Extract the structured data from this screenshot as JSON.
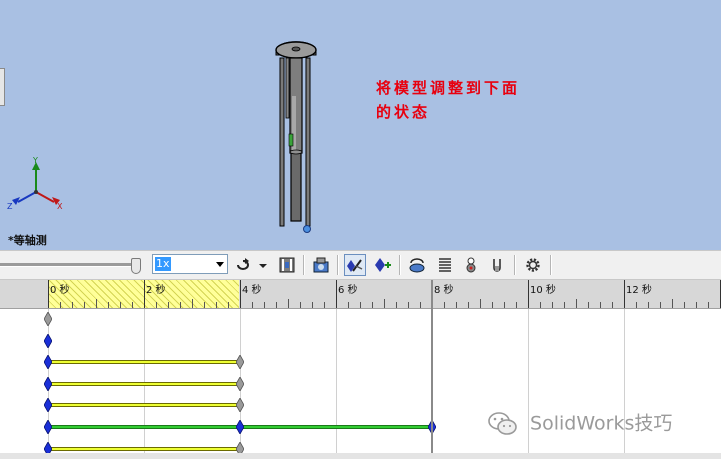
{
  "viewport": {
    "annotation_line1": "将模型调整到下面",
    "annotation_line2": "的状态",
    "view_name": "*等轴测",
    "axis_labels": {
      "y": "Y",
      "x": "X",
      "z": "Z"
    },
    "background_color": "#a9c0e3",
    "annotation_color": "#e8000f"
  },
  "toolbar": {
    "speed_value": "1x",
    "slider_position": 1.0,
    "icons": [
      "playback-mode-icon",
      "save-animation-icon",
      "animation-wizard-icon",
      "autokey-icon",
      "add-key-icon",
      "motor-icon",
      "spring-icon",
      "gravity-icon",
      "contact-icon",
      "settings-icon"
    ]
  },
  "timeline": {
    "unit": "秒",
    "ticks": [
      {
        "label": "0 秒",
        "seconds": 0
      },
      {
        "label": "2 秒",
        "seconds": 2
      },
      {
        "label": "4 秒",
        "seconds": 4
      },
      {
        "label": "6 秒",
        "seconds": 6
      },
      {
        "label": "8 秒",
        "seconds": 8
      },
      {
        "label": "10 秒",
        "seconds": 10
      },
      {
        "label": "12 秒",
        "seconds": 12
      }
    ],
    "current_time_seconds": 8,
    "highlighted_range_seconds": [
      0,
      4
    ],
    "tracks": [
      {
        "start": 0,
        "end": null,
        "start_key": "gray",
        "end_key": null
      },
      {
        "start": 0,
        "end": null,
        "start_key": "blue",
        "end_key": null
      },
      {
        "start": 0,
        "end": 4,
        "start_key": "blue",
        "end_key": "gray",
        "bar": "yellow"
      },
      {
        "start": 0,
        "end": 4,
        "start_key": "blue",
        "end_key": "gray",
        "bar": "yellow"
      },
      {
        "start": 0,
        "end": 4,
        "start_key": "blue",
        "end_key": "gray",
        "bar": "yellow"
      },
      {
        "start": 0,
        "end": 8,
        "start_key": "blue",
        "end_key": "blue",
        "mid_key": 4,
        "bar": "green"
      },
      {
        "start": 0,
        "end": 4,
        "start_key": "blue",
        "end_key": "gray",
        "bar": "yellow"
      }
    ],
    "colors": {
      "yellow_bar": "#eeff33",
      "green_bar": "#33cc33",
      "blue_key": "#1a2fd8",
      "gray_key": "#9a9a9a"
    }
  },
  "watermark": {
    "text": "SolidWorks技巧"
  }
}
